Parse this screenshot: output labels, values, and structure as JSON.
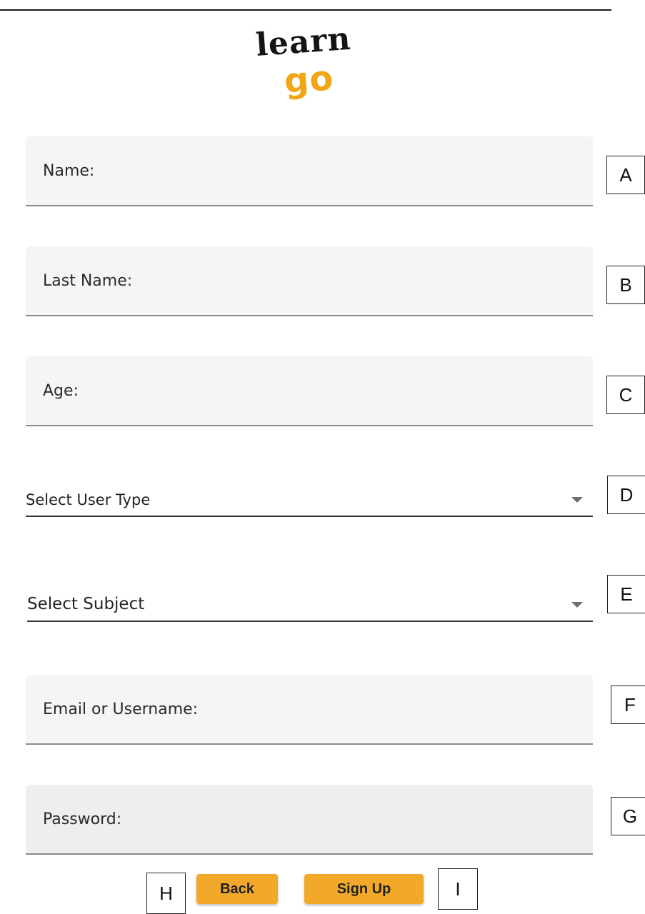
{
  "logo": {
    "word_top": "learn",
    "word_bottom": "go",
    "colors": {
      "top": "#141414",
      "bottom": "#f2a515"
    }
  },
  "form": {
    "name_label": "Name:",
    "last_name_label": "Last Name:",
    "age_label": "Age:",
    "user_type_select": "Select User Type",
    "subject_select": "Select Subject",
    "email_label": "Email or Username:",
    "password_label": "Password:"
  },
  "buttons": {
    "back_label": "Back",
    "signup_label": "Sign Up"
  },
  "markers": {
    "a": "A",
    "b": "B",
    "c": "C",
    "d": "D",
    "e": "E",
    "f": "F",
    "g": "G",
    "h": "H",
    "i": "I"
  },
  "icons": {
    "dropdown": "chevron-down-icon"
  },
  "colors": {
    "accent": "#f2a92a",
    "field_bg": "#f5f5f5"
  }
}
